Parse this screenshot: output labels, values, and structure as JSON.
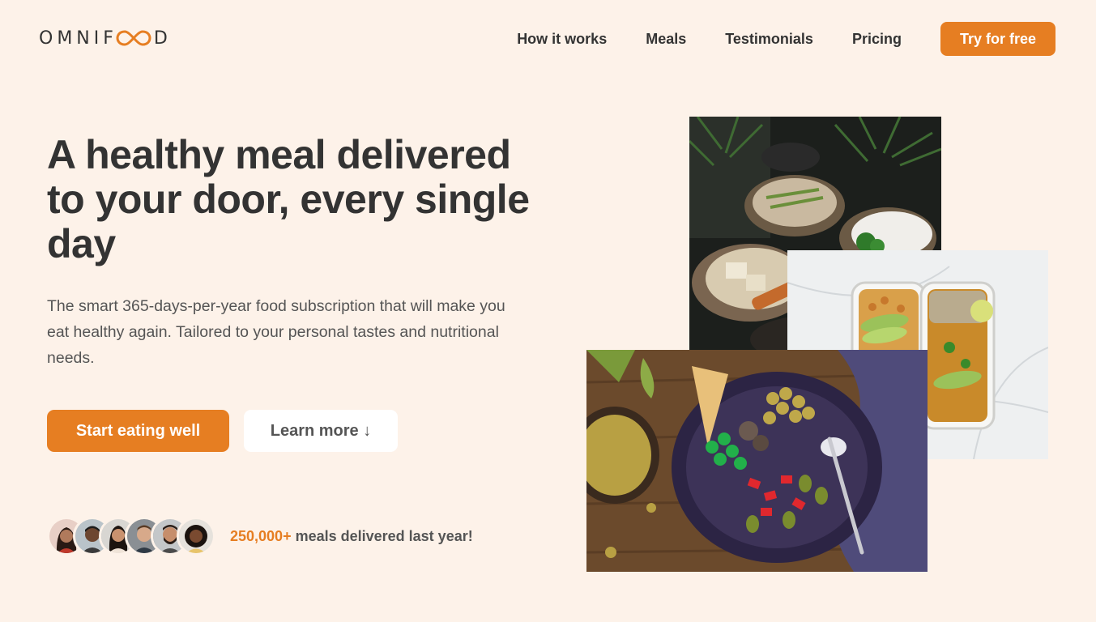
{
  "header": {
    "logo_text_left": "OMNIF",
    "logo_text_right": "D",
    "nav": [
      "How it works",
      "Meals",
      "Testimonials",
      "Pricing"
    ],
    "cta": "Try for free"
  },
  "hero": {
    "title": "A healthy meal delivered to your door, every single day",
    "description": "The smart 365-days-per-year food subscription that will make you eat healthy again. Tailored to your personal tastes and nutritional needs.",
    "primary_button": "Start eating well",
    "secondary_button": "Learn more ↓"
  },
  "delivered": {
    "highlight": "250,000+",
    "text": " meals delivered last year!",
    "avatar_count": 6
  },
  "colors": {
    "background": "#fdf2e9",
    "accent": "#e67e22",
    "text": "#333333"
  }
}
